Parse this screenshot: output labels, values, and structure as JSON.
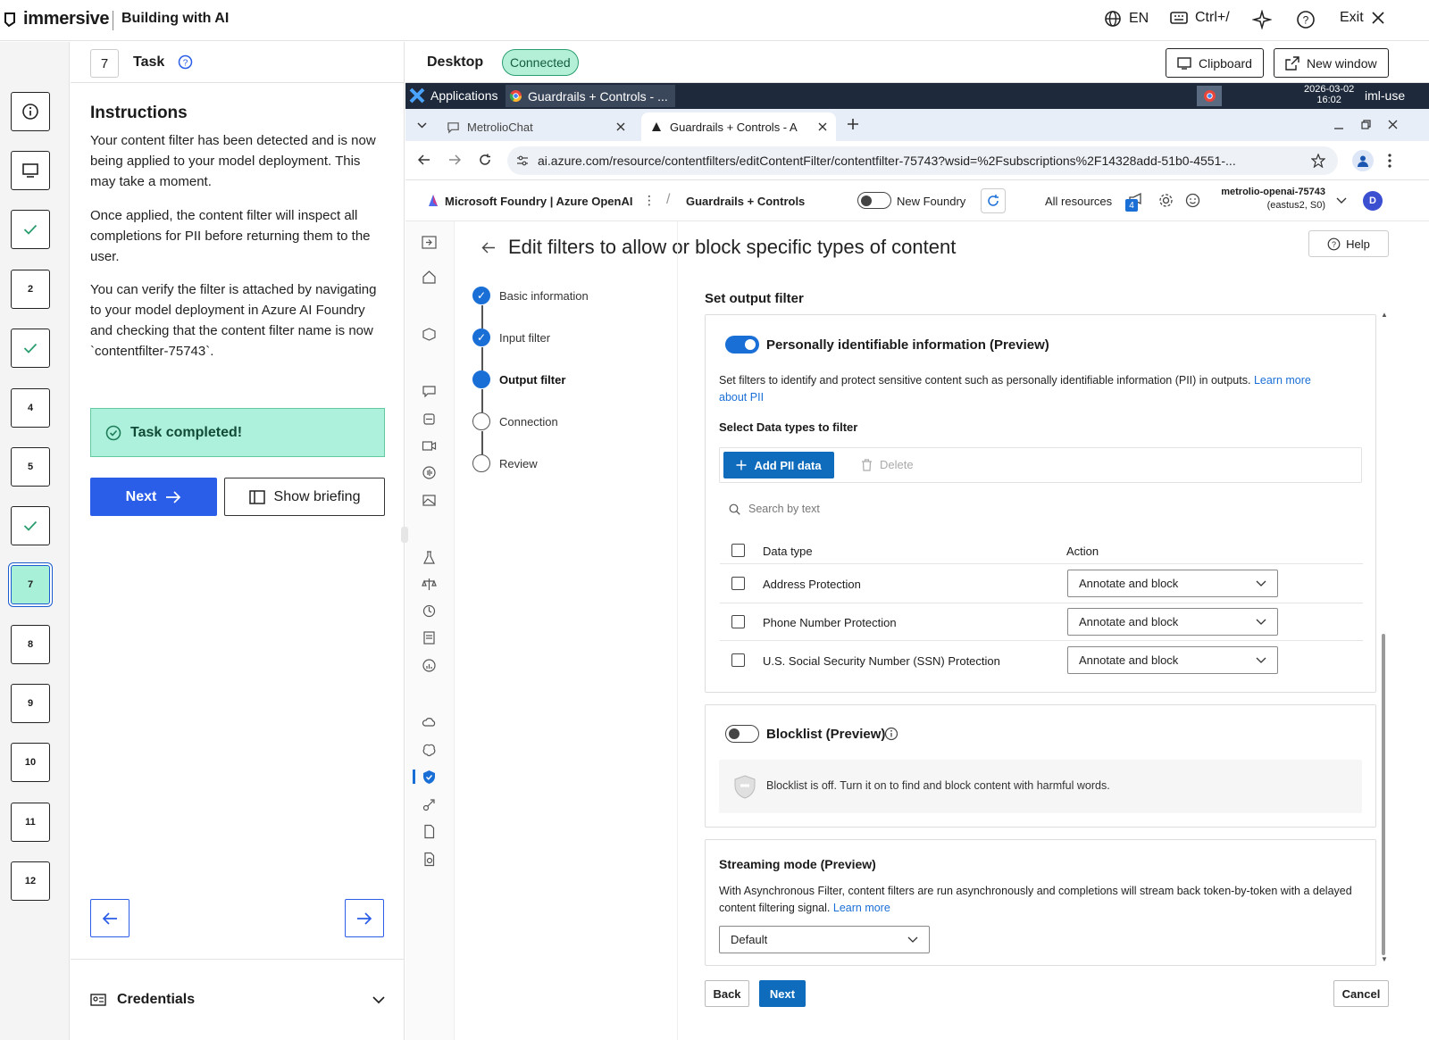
{
  "topbar": {
    "brand": "immersive",
    "title": "Building with AI",
    "language": "EN",
    "shortcut": "Ctrl+/",
    "exit": "Exit"
  },
  "steps": [
    {
      "label": "",
      "state": "info"
    },
    {
      "label": "",
      "state": "desktop"
    },
    {
      "label": "",
      "state": "done"
    },
    {
      "label": "2",
      "state": "todo"
    },
    {
      "label": "",
      "state": "done"
    },
    {
      "label": "4",
      "state": "todo"
    },
    {
      "label": "5",
      "state": "todo"
    },
    {
      "label": "",
      "state": "done"
    },
    {
      "label": "7",
      "state": "active"
    },
    {
      "label": "8",
      "state": "todo"
    },
    {
      "label": "9",
      "state": "todo"
    },
    {
      "label": "10",
      "state": "todo"
    },
    {
      "label": "11",
      "state": "todo"
    },
    {
      "label": "12",
      "state": "todo"
    }
  ],
  "task": {
    "number": "7",
    "label": "Task",
    "instructions_heading": "Instructions",
    "para1": "Your content filter has been detected and is now being applied to your model deployment. This may take a moment.",
    "para2": "Once applied, the content filter will inspect all completions for PII before returning them to the user.",
    "para3": "You can verify the filter is attached by navigating to your model deployment in Azure AI Foundry and checking that the content filter name is now `contentfilter-75743`.",
    "completed": "Task completed!",
    "next": "Next",
    "show_briefing": "Show briefing",
    "credentials": "Credentials"
  },
  "desktop": {
    "label": "Desktop",
    "status": "Connected",
    "clipboard": "Clipboard",
    "new_window": "New window"
  },
  "vm": {
    "applications": "Applications",
    "active_window": "Guardrails + Controls - ...",
    "date": "2026-03-02",
    "time": "16:02",
    "user": "iml-use",
    "tab1": "MetrolioChat",
    "tab2": "Guardrails + Controls - A",
    "url": "ai.azure.com/resource/contentfilters/editContentFilter/contentfilter-75743?wsid=%2Fsubscriptions%2F14328add-51b0-4551-...",
    "product": "Microsoft Foundry | Azure OpenAI",
    "crumb": "Guardrails + Controls",
    "new_foundry": "New Foundry",
    "all_resources": "All resources",
    "notif_count": "4",
    "resource_name": "metrolio-openai-75743",
    "resource_region": "(eastus2, S0)",
    "avatar": "D"
  },
  "page": {
    "title": "Edit filters to allow or block specific types of content",
    "help": "Help",
    "wizard": [
      "Basic information",
      "Input filter",
      "Output filter",
      "Connection",
      "Review"
    ],
    "section_title": "Set output filter",
    "pii_title": "Personally identifiable information (Preview)",
    "pii_desc": "Set filters to identify and protect sensitive content such as personally identifiable information (PII) in outputs.",
    "pii_learn_1": "Learn more",
    "pii_learn_2": "about PII",
    "select_types": "Select Data types to filter",
    "add_pii": "Add PII data",
    "delete": "Delete",
    "search_placeholder": "Search by text",
    "col_type": "Data type",
    "col_action": "Action",
    "rows": [
      {
        "type": "Address Protection",
        "action": "Annotate and block"
      },
      {
        "type": "Phone Number Protection",
        "action": "Annotate and block"
      },
      {
        "type": "U.S. Social Security Number (SSN) Protection",
        "action": "Annotate and block"
      }
    ],
    "blocklist_title": "Blocklist (Preview)",
    "blocklist_off": "Blocklist is off. Turn it on to find and block content with harmful words.",
    "streaming_title": "Streaming mode (Preview)",
    "streaming_desc": "With Asynchronous Filter, content filters are run asynchronously and completions will stream back token-by-token with a delayed content filtering signal.",
    "streaming_learn": "Learn more",
    "streaming_value": "Default",
    "back": "Back",
    "next": "Next",
    "cancel": "Cancel"
  },
  "colors": {
    "primary": "#2a5de8",
    "azure_blue": "#1a6fd6",
    "success_bg": "#adf1dc",
    "taskbar": "#1e2a3c"
  }
}
